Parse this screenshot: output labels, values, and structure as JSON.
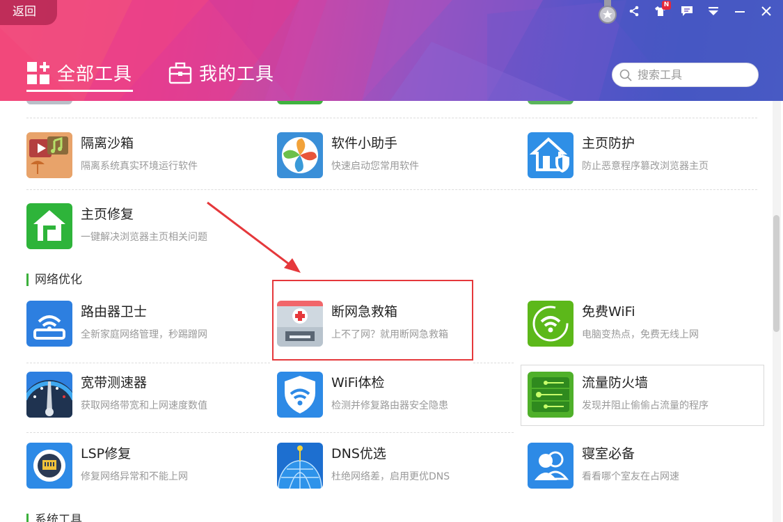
{
  "header": {
    "back_label": "返回",
    "notification_badge": "N",
    "tabs": [
      {
        "label": "全部工具",
        "active": true
      },
      {
        "label": "我的工具",
        "active": false
      }
    ],
    "search_placeholder": "搜索工具"
  },
  "sections": {
    "network": "网络优化",
    "system": "系统工具"
  },
  "tools": {
    "sandbox": {
      "title": "隔离沙箱",
      "desc": "隔离系统真实环境运行软件"
    },
    "helper": {
      "title": "软件小助手",
      "desc": "快速启动您常用软件"
    },
    "homepage_protect": {
      "title": "主页防护",
      "desc": "防止恶意程序篡改浏览器主页"
    },
    "homepage_repair": {
      "title": "主页修复",
      "desc": "一键解决浏览器主页相关问题"
    },
    "router_guard": {
      "title": "路由器卫士",
      "desc": "全新家庭网络管理，秒踢蹭网"
    },
    "net_firstaid": {
      "title": "断网急救箱",
      "desc": "上不了网？就用断网急救箱"
    },
    "free_wifi": {
      "title": "免费WiFi",
      "desc": "电脑变热点，免费无线上网"
    },
    "speed_test": {
      "title": "宽带测速器",
      "desc": "获取网络带宽和上网速度数值"
    },
    "wifi_check": {
      "title": "WiFi体检",
      "desc": "检测并修复路由器安全隐患"
    },
    "firewall": {
      "title": "流量防火墙",
      "desc": "发现并阻止偷偷占流量的程序"
    },
    "lsp_repair": {
      "title": "LSP修复",
      "desc": "修复网络异常和不能上网"
    },
    "dns": {
      "title": "DNS优选",
      "desc": "杜绝网络差，启用更优DNS"
    },
    "dorm": {
      "title": "寝室必备",
      "desc": "看看哪个室友在占网速"
    }
  },
  "colors": {
    "accent_green": "#3cb03c",
    "highlight_red": "#e5383b",
    "header_pink": "#f04880",
    "header_blue": "#4a5cc6"
  }
}
